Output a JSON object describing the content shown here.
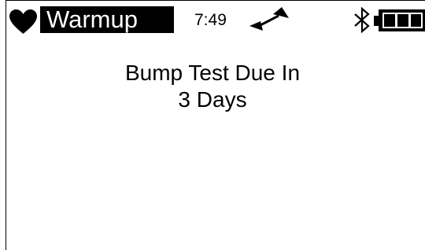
{
  "status_bar": {
    "mode": "Warmup",
    "time": "7:49",
    "icons": {
      "heart": "heart-icon",
      "signal": "signal-indicator-icon",
      "bluetooth": "bluetooth-icon",
      "battery": "battery-icon"
    },
    "battery_level": 1.0
  },
  "message": {
    "line1": "Bump Test Due In",
    "line2": "3 Days"
  },
  "colors": {
    "foreground": "#000000",
    "background": "#ffffff"
  }
}
